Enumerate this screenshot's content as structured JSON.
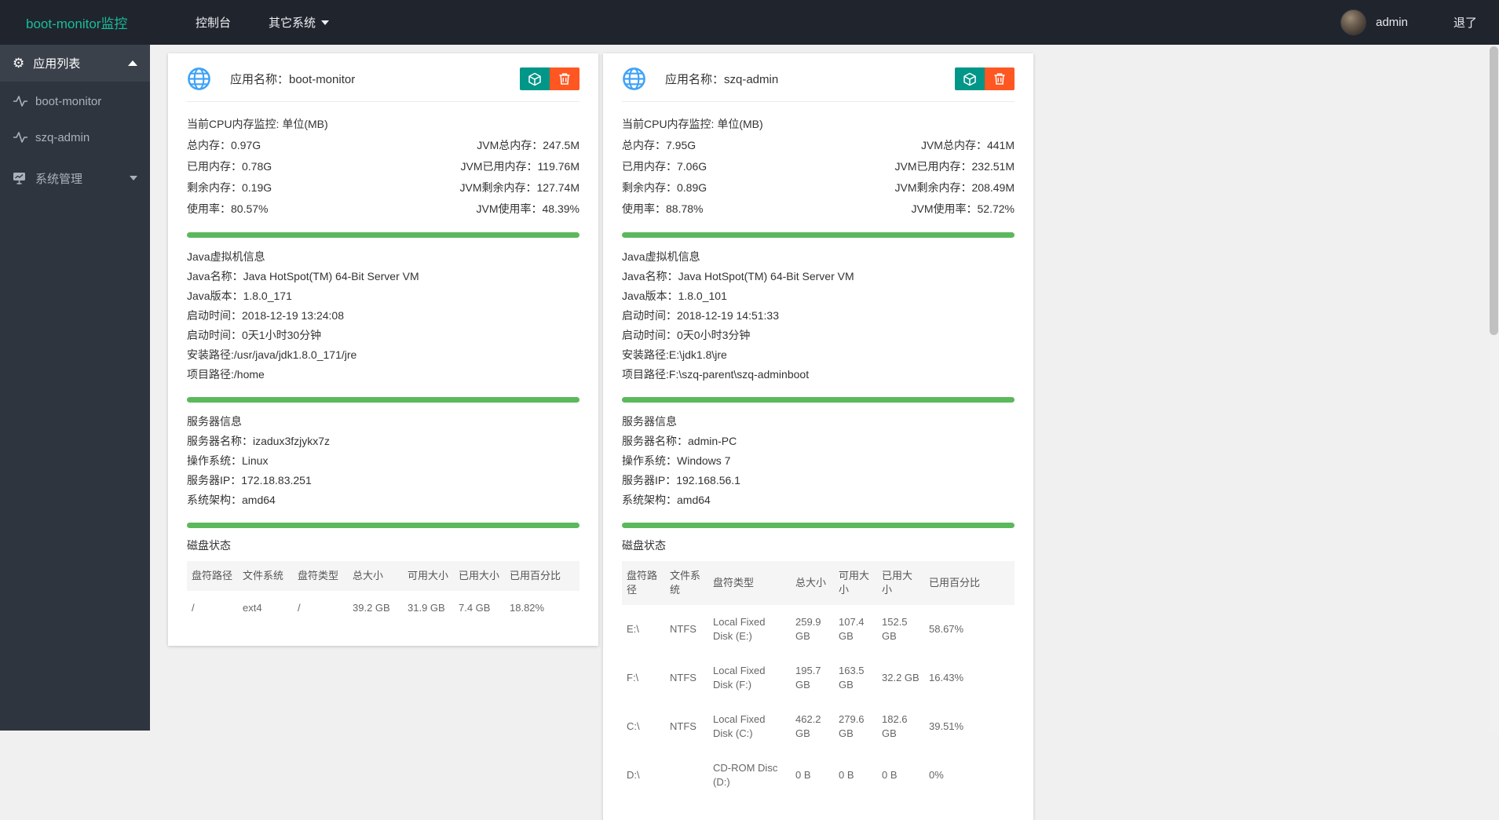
{
  "navbar": {
    "brand": "boot-monitor监控",
    "console_label": "控制台",
    "other_systems_label": "其它系统",
    "user": "admin",
    "logout": "退了"
  },
  "sidebar": {
    "header_label": "应用列表",
    "apps": [
      {
        "label": "boot-monitor"
      },
      {
        "label": "szq-admin"
      }
    ],
    "system_label": "系统管理"
  },
  "colors": {
    "accent_teal": "#1abc9c",
    "button_green": "#009688",
    "button_red": "#ff5722",
    "bar_green": "#5cb85c",
    "globe_blue": "#3fa2f7"
  },
  "cards": [
    {
      "title": "应用名称：boot-monitor",
      "cpu": {
        "heading": "当前CPU内存监控: 单位(MB)",
        "rows": [
          {
            "left": "总内存：0.97G",
            "right": "JVM总内存：247.5M"
          },
          {
            "left": "已用内存：0.78G",
            "right": "JVM已用内存：119.76M"
          },
          {
            "left": "剩余内存：0.19G",
            "right": "JVM剩余内存：127.74M"
          },
          {
            "left": "使用率：80.57%",
            "right": "JVM使用率：48.39%"
          }
        ]
      },
      "jvm_info": {
        "heading": "Java虚拟机信息",
        "lines": [
          "Java名称：Java HotSpot(TM) 64-Bit Server VM",
          "Java版本：1.8.0_171",
          "启动时间：2018-12-19 13:24:08",
          "启动时间：0天1小时30分钟",
          "安装路径:/usr/java/jdk1.8.0_171/jre",
          "项目路径:/home"
        ]
      },
      "server_info": {
        "heading": "服务器信息",
        "lines": [
          "服务器名称：izadux3fzjykx7z",
          "操作系统：Linux",
          "服务器IP：172.18.83.251",
          "系统架构：amd64"
        ]
      },
      "disk": {
        "heading": "磁盘状态",
        "columns": [
          "盘符路径",
          "文件系统",
          "盘符类型",
          "总大小",
          "可用大小",
          "已用大小",
          "已用百分比"
        ],
        "rows": [
          [
            "/",
            "ext4",
            "/",
            "39.2 GB",
            "31.9 GB",
            "7.4 GB",
            "18.82%"
          ]
        ]
      }
    },
    {
      "title": "应用名称：szq-admin",
      "cpu": {
        "heading": "当前CPU内存监控: 单位(MB)",
        "rows": [
          {
            "left": "总内存：7.95G",
            "right": "JVM总内存：441M"
          },
          {
            "left": "已用内存：7.06G",
            "right": "JVM已用内存：232.51M"
          },
          {
            "left": "剩余内存：0.89G",
            "right": "JVM剩余内存：208.49M"
          },
          {
            "left": "使用率：88.78%",
            "right": "JVM使用率：52.72%"
          }
        ]
      },
      "jvm_info": {
        "heading": "Java虚拟机信息",
        "lines": [
          "Java名称：Java HotSpot(TM) 64-Bit Server VM",
          "Java版本：1.8.0_101",
          "启动时间：2018-12-19 14:51:33",
          "启动时间：0天0小时3分钟",
          "安装路径:E:\\jdk1.8\\jre",
          "项目路径:F:\\szq-parent\\szq-adminboot"
        ]
      },
      "server_info": {
        "heading": "服务器信息",
        "lines": [
          "服务器名称：admin-PC",
          "操作系统：Windows 7",
          "服务器IP：192.168.56.1",
          "系统架构：amd64"
        ]
      },
      "disk": {
        "heading": "磁盘状态",
        "columns": [
          "盘符路径",
          "文件系统",
          "盘符类型",
          "总大小",
          "可用大小",
          "已用大小",
          "已用百分比"
        ],
        "rows": [
          [
            "E:\\",
            "NTFS",
            "Local Fixed Disk (E:)",
            "259.9 GB",
            "107.4 GB",
            "152.5 GB",
            "58.67%"
          ],
          [
            "F:\\",
            "NTFS",
            "Local Fixed Disk (F:)",
            "195.7 GB",
            "163.5 GB",
            "32.2 GB",
            "16.43%"
          ],
          [
            "C:\\",
            "NTFS",
            "Local Fixed Disk (C:)",
            "462.2 GB",
            "279.6 GB",
            "182.6 GB",
            "39.51%"
          ],
          [
            "D:\\",
            "",
            "CD-ROM Disc (D:)",
            "0 B",
            "0 B",
            "0 B",
            "0%"
          ]
        ]
      }
    }
  ]
}
